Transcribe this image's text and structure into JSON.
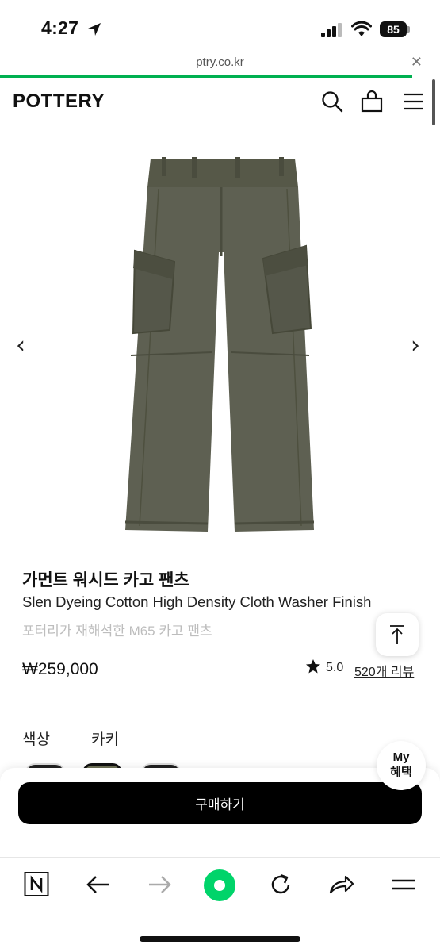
{
  "status_bar": {
    "time": "4:27",
    "battery": "85",
    "icons": [
      "location-arrow-icon",
      "signal-icon",
      "wifi-icon",
      "battery-icon"
    ]
  },
  "browser": {
    "url": "ptry.co.kr",
    "close_icon": "close-icon",
    "accent_color": "#00b050"
  },
  "header": {
    "logo": "POTTERY",
    "icons": [
      "search-icon",
      "bag-icon",
      "menu-icon"
    ]
  },
  "product": {
    "title": "가먼트 워시드 카고 팬츠",
    "subtitle": "Slen Dyeing Cotton High Density Cloth Washer Finish",
    "description": "포터리가 재해석한 M65 카고 팬츠",
    "price": "₩259,000",
    "rating": "5.0",
    "reviews": "520개 리뷰",
    "image_color": "#5e6052",
    "nav_prev": "‹",
    "nav_next": "›"
  },
  "options": {
    "color_label": "색상",
    "color_value": "카키",
    "swatches": [
      "#222222",
      "#6f7257",
      "#2a2a2a"
    ]
  },
  "actions": {
    "buy_label": "구매하기",
    "my_benefit_line1": "My",
    "my_benefit_line2": "혜택"
  },
  "toolbar": {
    "icons": [
      "naver-n-icon",
      "back-arrow-icon",
      "forward-arrow-icon",
      "green-dot-icon",
      "reload-icon",
      "share-icon",
      "menu-lines-icon"
    ]
  }
}
